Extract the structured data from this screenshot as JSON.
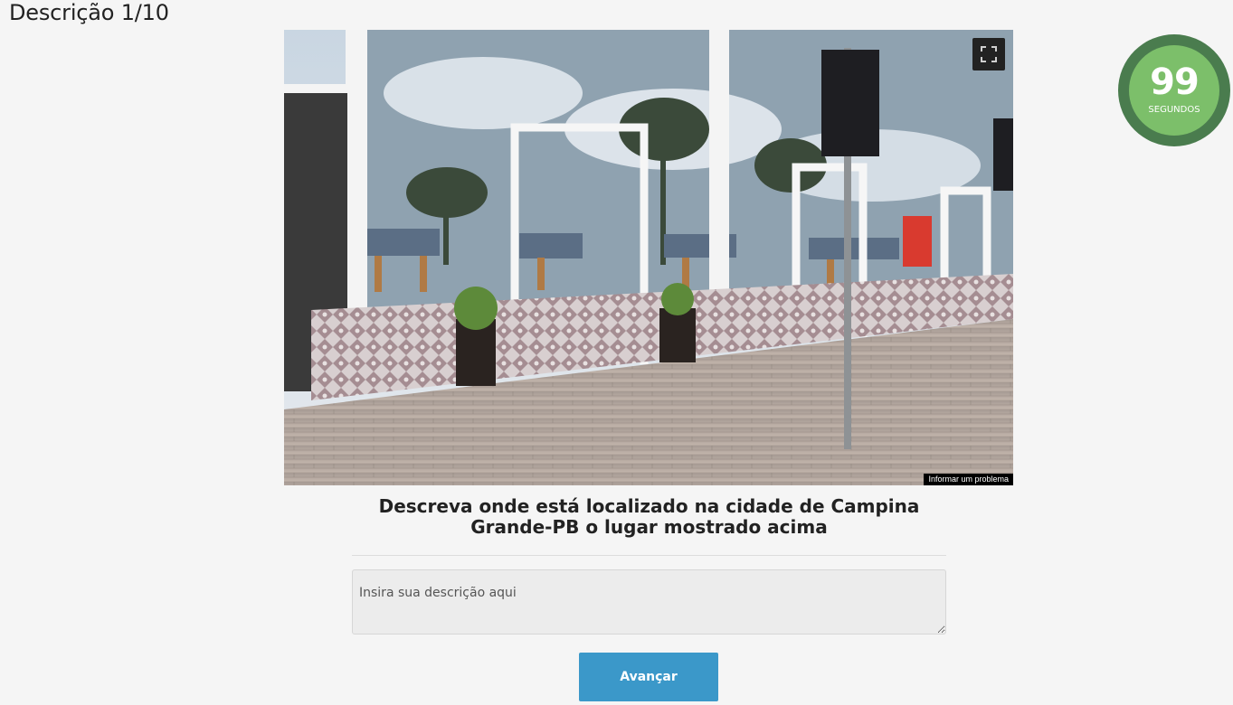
{
  "header": {
    "title": "Descrição 1/10"
  },
  "timer": {
    "value": "99",
    "unit": "SEGUNDOS",
    "remaining_fraction": 0.99,
    "ring_color": "#4a7c4e",
    "inner_color": "#7cbf6a"
  },
  "panorama": {
    "fullscreen_icon": "fullscreen-icon",
    "report_label": "Informar um problema"
  },
  "question": {
    "text": "Descreva onde está localizado na cidade de Campina Grande-PB o lugar mostrado acima"
  },
  "description": {
    "placeholder": "Insira sua descrição aqui",
    "value": ""
  },
  "actions": {
    "advance_label": "Avançar",
    "accent": "#3b98c9"
  }
}
